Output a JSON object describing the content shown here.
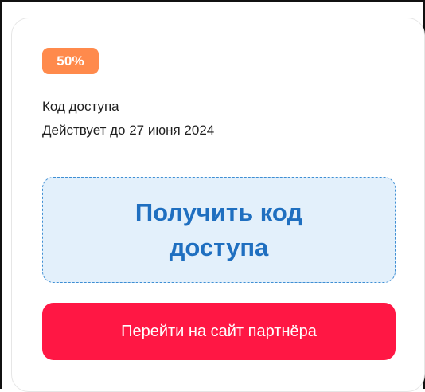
{
  "offer": {
    "discount_badge": "50%",
    "title": "Код доступа",
    "valid_until": "Действует до 27 июня 2024",
    "get_code_label": "Получить код доступа",
    "partner_button_label": "Перейти на сайт партнёра"
  },
  "colors": {
    "badge_bg": "#ff8a4c",
    "code_box_bg": "#e3f0fb",
    "code_box_border": "#3f8fd4",
    "code_box_text": "#1f6fc0",
    "primary_button_bg": "#ff1744"
  }
}
